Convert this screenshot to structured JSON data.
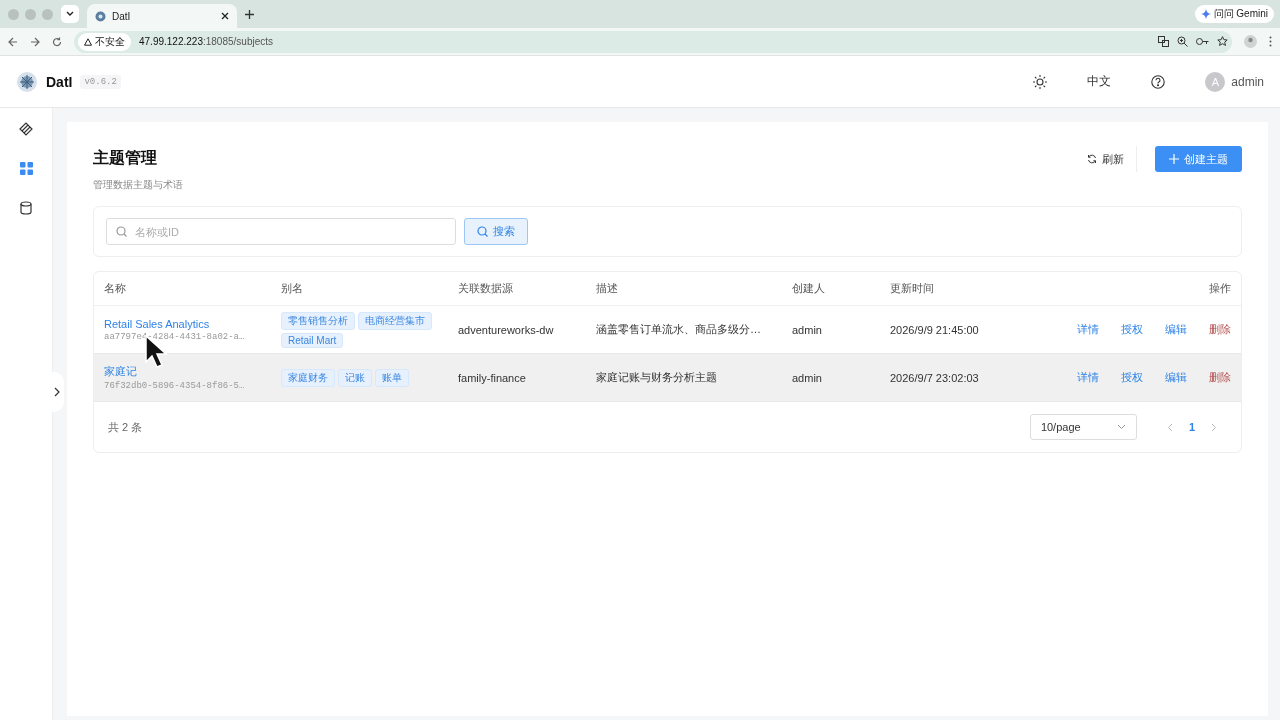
{
  "browser": {
    "tab_title": "DatI",
    "security_label": "不安全",
    "url_host": "47.99.122.223",
    "url_rest": ":18085/subjects",
    "gemini_label": "问问 Gemini"
  },
  "header": {
    "app_name": "DatI",
    "version": "v0.6.2",
    "language": "中文",
    "user_initial": "A",
    "user_name": "admin"
  },
  "sidebar": {
    "items": [
      {
        "kind": "layers",
        "selected": false
      },
      {
        "kind": "grid",
        "selected": true
      },
      {
        "kind": "database",
        "selected": false
      }
    ]
  },
  "page": {
    "title": "主题管理",
    "subtitle": "管理数据主题与术语",
    "refresh_label": "刷新",
    "create_label": "创建主题"
  },
  "search": {
    "placeholder": "名称或ID",
    "button_label": "搜索"
  },
  "table": {
    "columns": [
      "名称",
      "别名",
      "关联数据源",
      "描述",
      "创建人",
      "更新时间",
      "操作"
    ],
    "rows": [
      {
        "name": "Retail Sales Analytics",
        "id": "aa7797e4-4284-4431-8a02-a…",
        "aliases": [
          "零售销售分析",
          "电商经营集市",
          "Retail Mart"
        ],
        "datasource": "adventureworks-dw",
        "description": "涵盖零售订单流水、商品多级分…",
        "creator": "admin",
        "updated": "2026/9/9 21:45:00",
        "actions": [
          "详情",
          "授权",
          "编辑",
          "删除"
        ],
        "highlighted": false
      },
      {
        "name": "家庭记",
        "id": "76f32db0-5896-4354-8f86-5…",
        "aliases": [
          "家庭财务",
          "记账",
          "账单"
        ],
        "datasource": "family-finance",
        "description": "家庭记账与财务分析主题",
        "creator": "admin",
        "updated": "2026/9/7 23:02:03",
        "actions": [
          "详情",
          "授权",
          "编辑",
          "删除"
        ],
        "highlighted": true
      }
    ]
  },
  "pagination": {
    "total": "共 2 条",
    "page_size": "10/page",
    "pages": [
      {
        "label": "1",
        "selected": true
      }
    ]
  }
}
